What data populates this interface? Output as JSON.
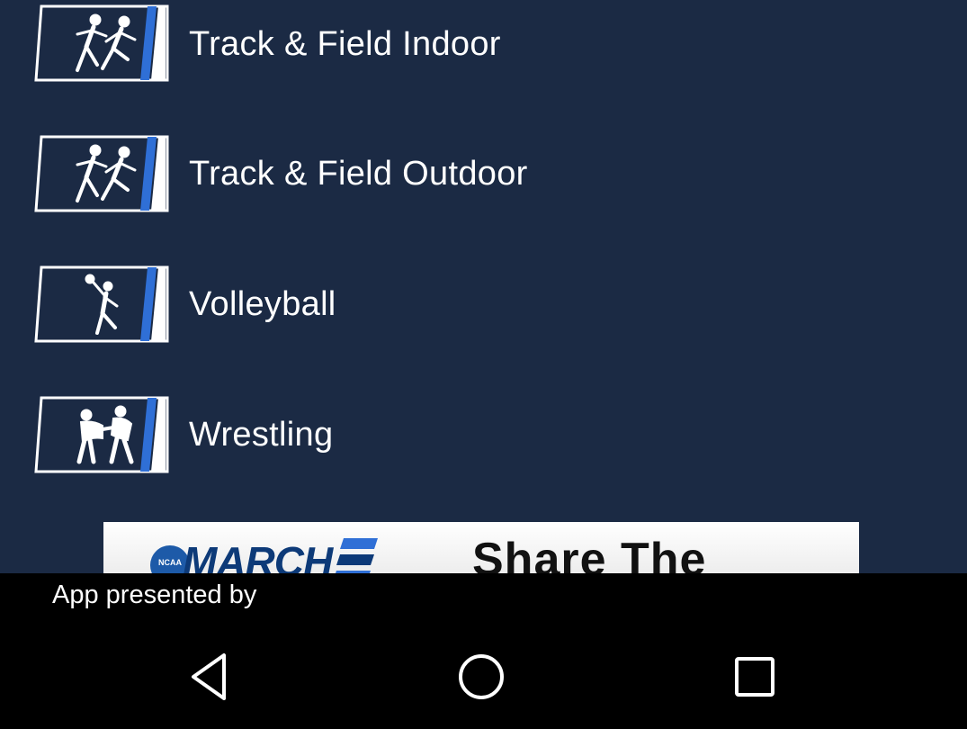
{
  "sports": [
    {
      "label": "Track & Field Indoor",
      "icon": "track-field-icon"
    },
    {
      "label": "Track & Field Outdoor",
      "icon": "track-field-icon"
    },
    {
      "label": "Volleyball",
      "icon": "volleyball-icon"
    },
    {
      "label": "Wrestling",
      "icon": "wrestling-icon"
    }
  ],
  "ad": {
    "logo_text": "NCAA",
    "brand": "MARCH",
    "headline": "Share The"
  },
  "footer": {
    "presented_by": "App presented by"
  },
  "nav": {
    "back": "back-icon",
    "home": "home-icon",
    "recents": "recents-icon"
  },
  "colors": {
    "background": "#1b2a44",
    "icon_stripe": "#2f6fd6",
    "text": "#ffffff",
    "footer": "#000000"
  }
}
